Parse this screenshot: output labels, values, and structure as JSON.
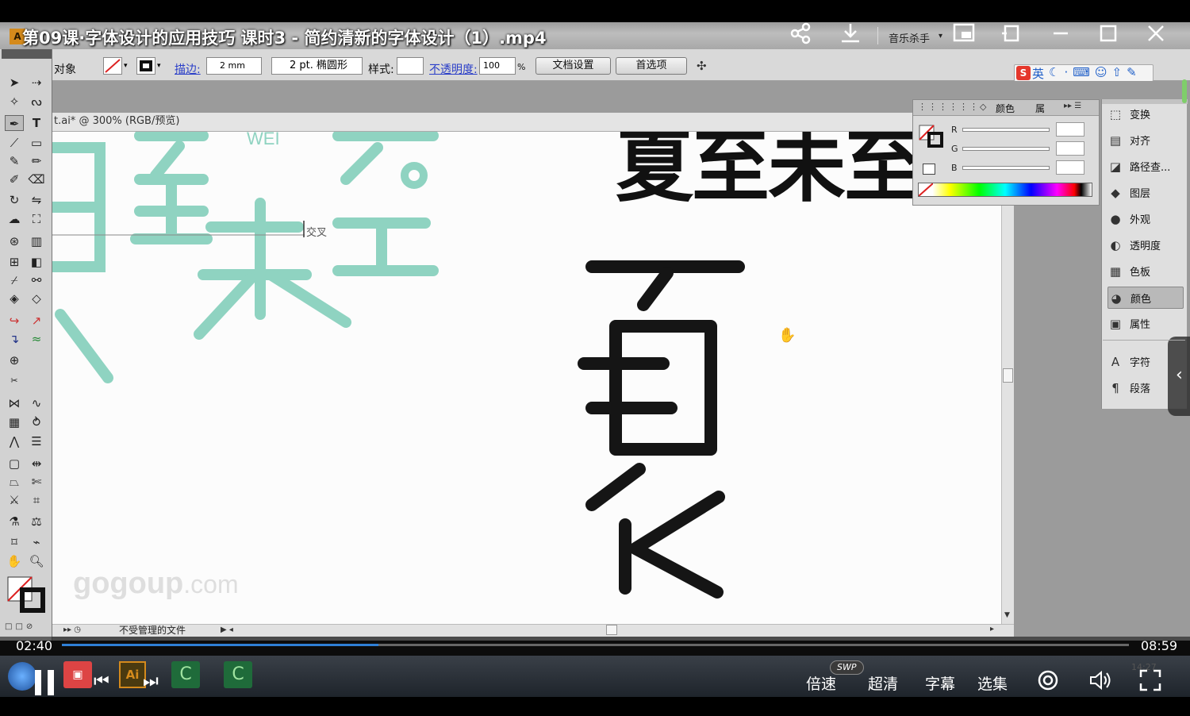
{
  "video": {
    "title": "第09课·字体设计的应用技巧 课时3 - 简约清新的字体设计（1）.mp4",
    "elapsed": "02:40",
    "duration": "08:59",
    "progress": 0.297
  },
  "titlebar": {
    "app_label": "音乐杀手",
    "icons": [
      "share-icon",
      "download-icon",
      "pip-icon",
      "pin-icon",
      "minimize-icon",
      "maximize-icon",
      "close-icon"
    ]
  },
  "controlbar": {
    "object_label": "对象",
    "stroke_label": "描边:",
    "stroke_value": "2 mm",
    "brush_value": "2 pt. 椭圆形",
    "style_label": "样式:",
    "opacity_label": "不透明度:",
    "opacity_value": "100",
    "percent": "%",
    "doc_setup_button": "文档设置",
    "prefs_button": "首选项",
    "ime_label": "英"
  },
  "document": {
    "tab_title": "t.ai* @ 300% (RGB/预览)",
    "smart_guide_label": "交叉",
    "status_text": "不受管理的文件",
    "watermark_main": "gogoup",
    "watermark_suffix": ".com",
    "top_big_text": "夏至未至"
  },
  "color_panel": {
    "tab_label": "颜色",
    "tab2_label": "属",
    "r_label": "R",
    "g_label": "G",
    "b_label": "B"
  },
  "right_panel": {
    "items": [
      {
        "label": "变换",
        "icon": "transform-icon"
      },
      {
        "label": "对齐",
        "icon": "align-icon"
      },
      {
        "label": "路径查...",
        "icon": "pathfinder-icon"
      },
      {
        "label": "图层",
        "icon": "layers-icon"
      },
      {
        "label": "外观",
        "icon": "appearance-icon"
      },
      {
        "label": "透明度",
        "icon": "transparency-icon"
      },
      {
        "label": "色板",
        "icon": "swatches-icon"
      },
      {
        "label": "颜色",
        "icon": "color-icon"
      },
      {
        "label": "属性",
        "icon": "attributes-icon"
      },
      {
        "label": "字符",
        "icon": "character-icon"
      },
      {
        "label": "段落",
        "icon": "paragraph-icon"
      }
    ],
    "active_index": 7
  },
  "player": {
    "speed_label": "倍速",
    "swp_badge": "SWP",
    "quality_label": "超清",
    "subtitle_label": "字幕",
    "episodes_label": "选集",
    "taskbar_ai_label": "Ai",
    "clock": "14:27"
  },
  "colors": {
    "mint": "#8fd3c1",
    "accent_blue": "#2f7fd6",
    "glyph_black": "#151515"
  }
}
